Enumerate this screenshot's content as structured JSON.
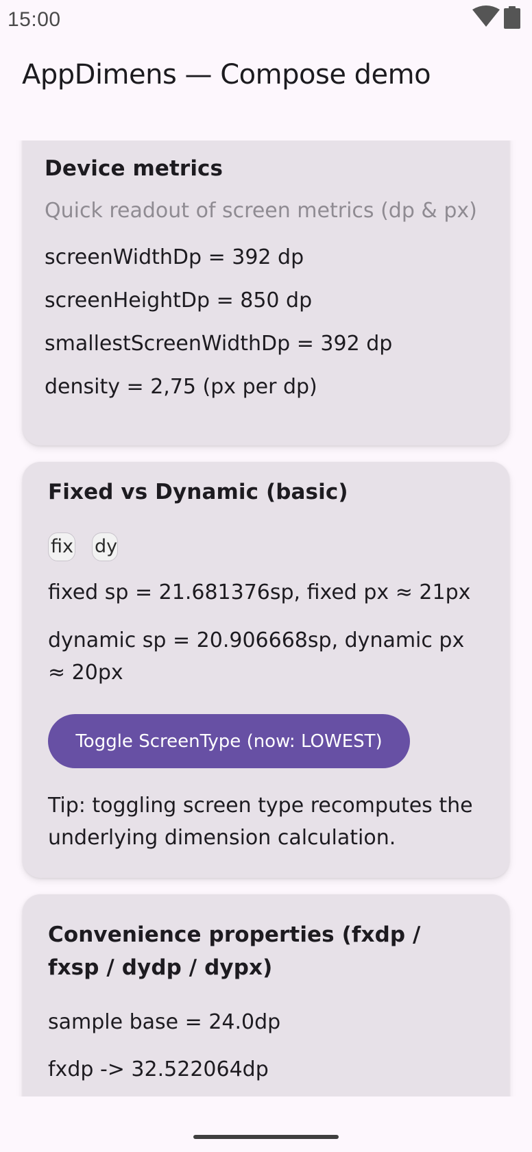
{
  "status_bar": {
    "time": "15:00",
    "icons": [
      "wifi-icon",
      "battery-icon"
    ]
  },
  "app_bar": {
    "title": "AppDimens — Compose demo"
  },
  "colors": {
    "background": "#fdf7fd",
    "card": "#e7e1e8",
    "primary": "#6750a4",
    "on_primary": "#ffffff",
    "subtitle": "#8f8b92"
  },
  "cards": {
    "device_metrics": {
      "title": "Device metrics",
      "subtitle": "Quick readout of screen metrics (dp & px)",
      "lines": [
        "screenWidthDp = 392 dp",
        "screenHeightDp = 850 dp",
        "smallestScreenWidthDp = 392 dp",
        "density = 2,75 (px per dp)"
      ]
    },
    "fixed_vs_dynamic": {
      "title": "Fixed vs Dynamic (basic)",
      "chips": [
        "fix",
        "dy"
      ],
      "fixed_line": "fixed sp = 21.681376sp, fixed px ≈ 21px",
      "dynamic_line": "dynamic sp = 20.906668sp, dynamic px ≈ 20px",
      "toggle_button_label": "Toggle ScreenType (now: LOWEST)",
      "tip": "Tip: toggling screen type recomputes the underlying dimension calculation."
    },
    "convenience": {
      "title": "Convenience properties (fxdp / fxsp / dydp / dypx)",
      "lines": [
        "sample base = 24.0dp",
        "fxdp -> 32.522064dp"
      ]
    }
  }
}
